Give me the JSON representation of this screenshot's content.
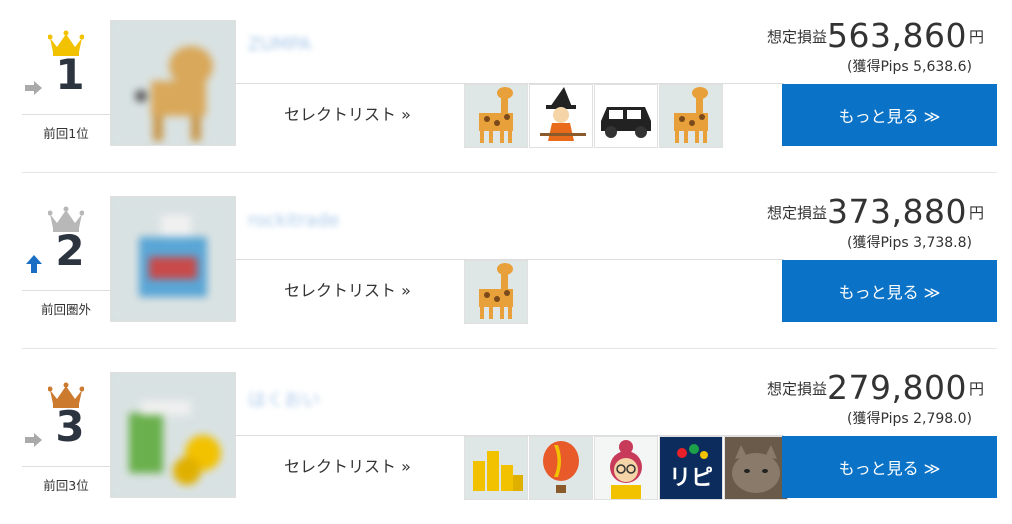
{
  "rows": [
    {
      "rank": "1",
      "crown_color": "#f2c100",
      "trend": "flat",
      "prev_label": "前回1位",
      "name": "ZUMPA",
      "select_label": "セレクトリスト »",
      "profit_label": "想定損益",
      "profit_value": "563,860",
      "profit_unit": "円",
      "pips": "(獲得Pips 5,638.6)",
      "more_label": "もっと見る ≫",
      "icons": [
        "giraffe-icon",
        "witch-icon",
        "car-icon",
        "giraffe-icon"
      ]
    },
    {
      "rank": "2",
      "crown_color": "#b8b8b8",
      "trend": "up",
      "prev_label": "前回圏外",
      "name": "rockitrade",
      "select_label": "セレクトリスト »",
      "profit_label": "想定損益",
      "profit_value": "373,880",
      "profit_unit": "円",
      "pips": "(獲得Pips 3,738.8)",
      "more_label": "もっと見る ≫",
      "icons": [
        "giraffe-icon"
      ]
    },
    {
      "rank": "3",
      "crown_color": "#cc7a2e",
      "trend": "flat",
      "prev_label": "前回3位",
      "name": "はくおい",
      "select_label": "セレクトリスト »",
      "profit_label": "想定損益",
      "profit_value": "279,800",
      "profit_unit": "円",
      "pips": "(獲得Pips 2,798.0)",
      "more_label": "もっと見る ≫",
      "icons": [
        "gold-coins-icon",
        "hot-air-balloon-icon",
        "woman-glasses-icon",
        "repeat-logo-icon",
        "cat-photo-icon"
      ]
    }
  ]
}
